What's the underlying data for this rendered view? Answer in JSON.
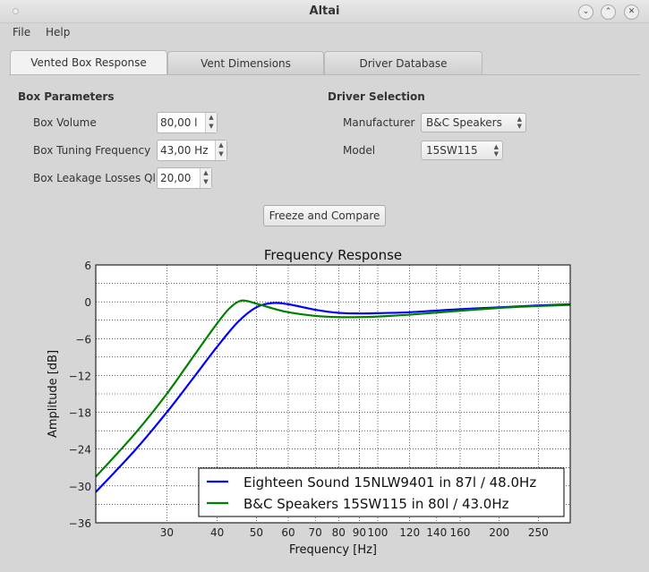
{
  "window": {
    "title": "Altai"
  },
  "menu": {
    "file": "File",
    "help": "Help"
  },
  "tabs": [
    {
      "label": "Vented Box Response",
      "active": true
    },
    {
      "label": "Vent Dimensions",
      "active": false
    },
    {
      "label": "Driver Database",
      "active": false
    }
  ],
  "box": {
    "heading": "Box Parameters",
    "volume_label": "Box Volume",
    "volume_value": "80,00 l",
    "tuning_label": "Box Tuning Frequency",
    "tuning_value": "43,00 Hz",
    "leak_label": "Box Leakage Losses Ql",
    "leak_value": "20,00"
  },
  "driver": {
    "heading": "Driver Selection",
    "manufacturer_label": "Manufacturer",
    "manufacturer_value": "B&C Speakers",
    "model_label": "Model",
    "model_value": "15SW115"
  },
  "freeze_label": "Freeze and Compare",
  "chart_data": {
    "type": "line",
    "title": "Frequency Response",
    "xlabel": "Frequency [Hz]",
    "ylabel": "Amplitude [dB]",
    "xscale": "log",
    "xlim": [
      20,
      300
    ],
    "ylim": [
      -36,
      6
    ],
    "xticks": [
      30,
      40,
      50,
      60,
      70,
      80,
      90,
      100,
      120,
      140,
      160,
      200,
      250
    ],
    "yticks": [
      6,
      0,
      -6,
      -12,
      -18,
      -24,
      -30,
      -36
    ],
    "grid": true,
    "legend": "bottom-right",
    "series": [
      {
        "name": "Eighteen Sound 15NLW9401 in 87l / 48.0Hz",
        "color": "#0000ff",
        "x": [
          20,
          25,
          30,
          35,
          40,
          45,
          50,
          55,
          60,
          70,
          80,
          90,
          100,
          120,
          150,
          200,
          250,
          300
        ],
        "y": [
          -31,
          -24.2,
          -18,
          -12.3,
          -7.3,
          -3.3,
          -0.9,
          -0.2,
          -0.4,
          -1.3,
          -1.8,
          -1.9,
          -1.85,
          -1.7,
          -1.3,
          -0.9,
          -0.6,
          -0.4
        ]
      },
      {
        "name": "B&C Speakers 15SW115 in 80l / 43.0Hz",
        "color": "#008000",
        "x": [
          20,
          25,
          30,
          35,
          40,
          43,
          46,
          50,
          55,
          60,
          70,
          80,
          90,
          100,
          120,
          150,
          200,
          250,
          300
        ],
        "y": [
          -28.5,
          -21.5,
          -15,
          -8.8,
          -3.5,
          -1,
          0.2,
          -0.3,
          -1.1,
          -1.7,
          -2.3,
          -2.5,
          -2.5,
          -2.4,
          -2.1,
          -1.6,
          -1.0,
          -0.7,
          -0.5
        ]
      }
    ]
  }
}
